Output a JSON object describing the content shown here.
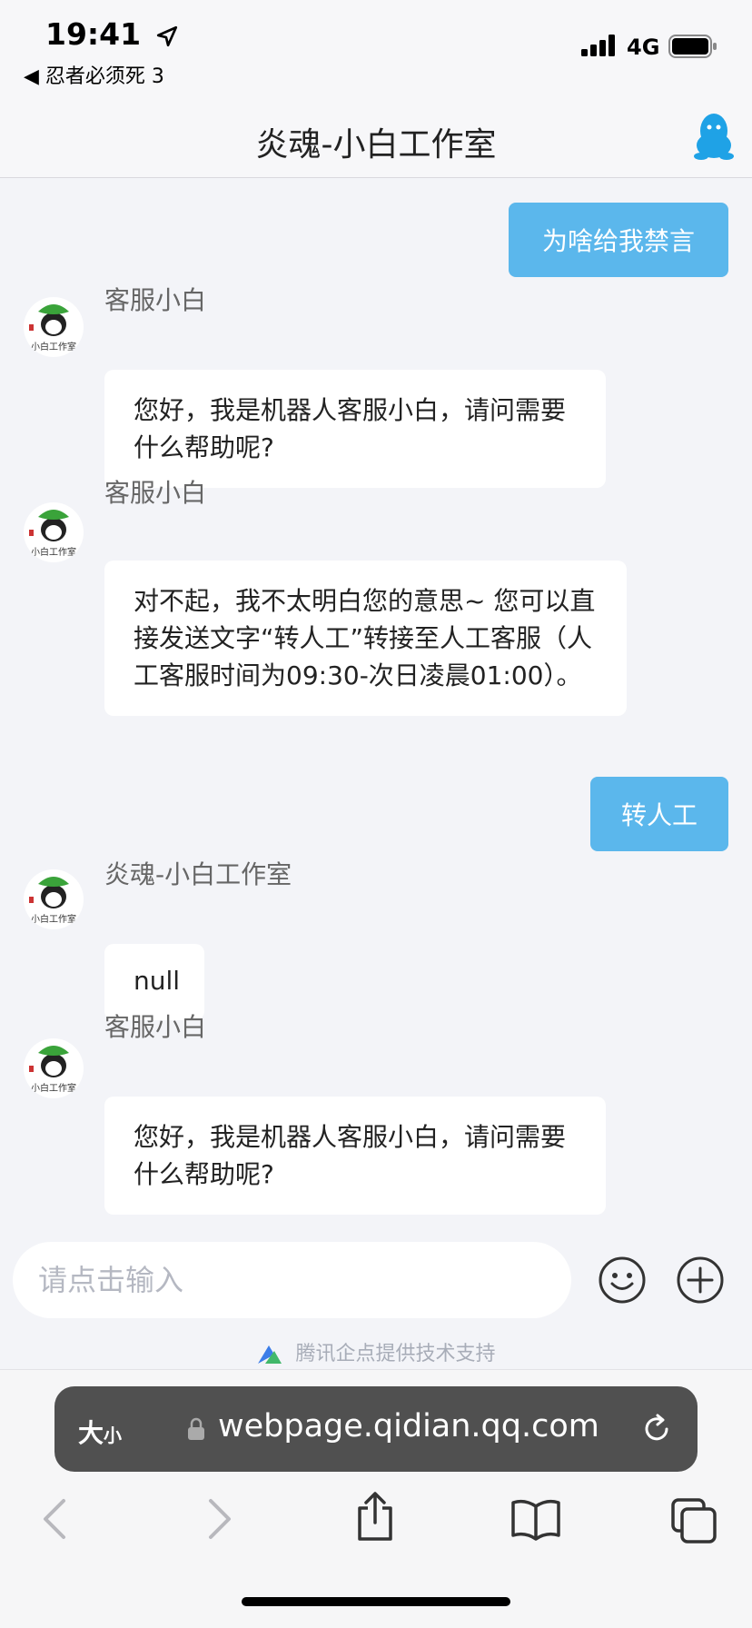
{
  "status_bar": {
    "time": "19:41",
    "back_app": "◀ 忍者必须死 3",
    "network": "4G"
  },
  "header": {
    "title": "炎魂-小白工作室"
  },
  "messages": [
    {
      "side": "out",
      "text": "为啥给我禁言"
    },
    {
      "side": "in",
      "sender": "客服小白",
      "text": "您好，我是机器人客服小白，请问需要什么帮助呢?"
    },
    {
      "side": "in",
      "sender": "客服小白",
      "text": "对不起，我不太明白您的意思~ 您可以直接发送文字“转人工”转接至人工客服（人工客服时间为09:30-次日凌晨01:00）。"
    },
    {
      "side": "out",
      "text": "转人工"
    },
    {
      "side": "in",
      "sender": "炎魂-小白工作室",
      "text": "null"
    },
    {
      "side": "in",
      "sender": "客服小白",
      "text": "您好，我是机器人客服小白，请问需要什么帮助呢?"
    }
  ],
  "input": {
    "placeholder": "请点击输入",
    "value": ""
  },
  "powered_by": "腾讯企点提供技术支持",
  "browser": {
    "text_size_label": "大",
    "text_size_small": "小",
    "url": "webpage.qidian.qq.com"
  },
  "colors": {
    "outgoing_bubble": "#5bb7ec",
    "incoming_bubble": "#ffffff",
    "chat_background": "#f3f4f8",
    "url_bar": "#505050"
  }
}
